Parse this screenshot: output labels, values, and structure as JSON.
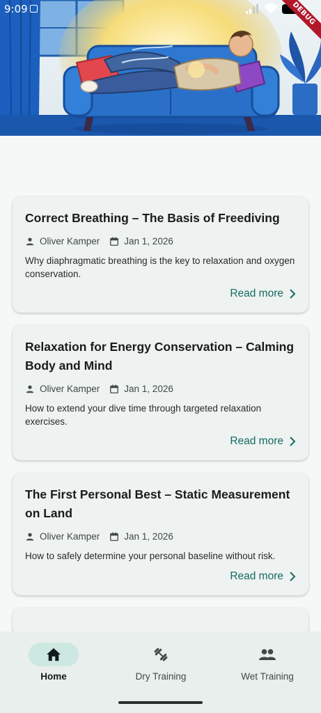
{
  "status_bar": {
    "time": "9:09",
    "debug_banner": "DEBUG"
  },
  "hero": {
    "image": "man-breathing-on-sofa-illustration"
  },
  "articles": [
    {
      "title": "Correct Breathing – The Basis of Freediving",
      "author": "Oliver Kamper",
      "date": "Jan 1, 2026",
      "excerpt": "Why diaphragmatic breathing is the key to relaxation and oxygen conservation.",
      "read_more": "Read more"
    },
    {
      "title": "Relaxation for Energy Conservation – Calming Body and Mind",
      "author": "Oliver Kamper",
      "date": "Jan 1, 2026",
      "excerpt": "How to extend your dive time through targeted relaxation exercises.",
      "read_more": "Read more"
    },
    {
      "title": "The First Personal Best – Static Measurement on Land",
      "author": "Oliver Kamper",
      "date": "Jan 1, 2026",
      "excerpt": "How to safely determine your personal baseline without risk.",
      "read_more": "Read more"
    }
  ],
  "bottom_nav": {
    "items": [
      {
        "label": "Home",
        "icon": "home-icon",
        "active": true
      },
      {
        "label": "Dry Training",
        "icon": "dumbbell-icon",
        "active": false
      },
      {
        "label": "Wet Training",
        "icon": "people-icon",
        "active": false
      }
    ]
  },
  "colors": {
    "accent": "#156b62",
    "active_pill": "#cde8e1",
    "background": "#f4f8f7",
    "card": "#eef2f1",
    "nav_background": "#e9efed"
  }
}
